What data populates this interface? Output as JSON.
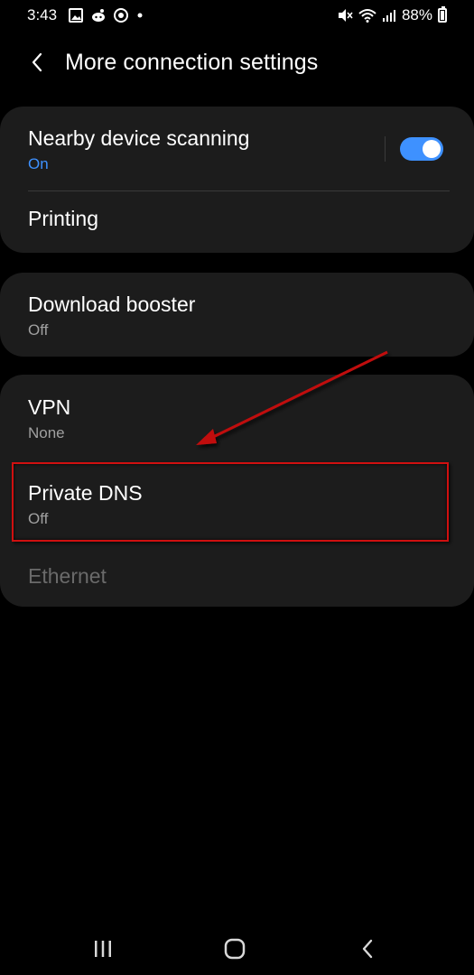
{
  "status_bar": {
    "time": "3:43",
    "left_icons": [
      "gallery-icon",
      "reddit-icon",
      "music-icon",
      "dot-icon"
    ],
    "right_icons": [
      "mute-icon",
      "wifi-icon",
      "signal-icon",
      "battery-icon"
    ],
    "battery_percent": "88%"
  },
  "header": {
    "title": "More connection settings"
  },
  "group1": {
    "nearby": {
      "title": "Nearby device scanning",
      "status": "On",
      "enabled": true
    },
    "printing": {
      "title": "Printing"
    }
  },
  "group2": {
    "download_booster": {
      "title": "Download booster",
      "status": "Off"
    }
  },
  "group3": {
    "vpn": {
      "title": "VPN",
      "status": "None"
    },
    "private_dns": {
      "title": "Private DNS",
      "status": "Off"
    },
    "ethernet": {
      "title": "Ethernet"
    }
  },
  "colors": {
    "accent": "#3e91ff",
    "annotation": "#d01010",
    "card": "#1c1c1c"
  },
  "nav_bar": {
    "icons": [
      "recents-icon",
      "home-icon",
      "back-icon"
    ]
  }
}
